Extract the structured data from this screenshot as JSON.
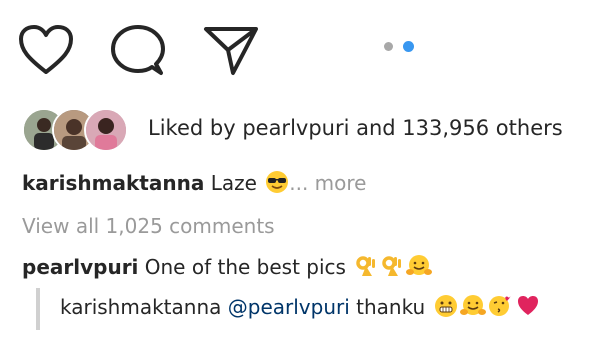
{
  "actions": {
    "icons": [
      "heart-icon",
      "comment-icon",
      "share-icon"
    ],
    "carousel": {
      "count": 2,
      "active_index": 1,
      "active_color": "#3897f0",
      "inactive_color": "#a8a8a8"
    }
  },
  "likes": {
    "prefix": "Liked by ",
    "username": "pearlvpuri",
    "suffix": " and 133,956 others"
  },
  "caption": {
    "username": "karishmaktanna",
    "text": "Laze",
    "emoji": "sunglasses-face-icon",
    "more": "... more"
  },
  "view_all": "View all 1,025 comments",
  "comment": {
    "username": "pearlvpuri",
    "text": "One of the best pics",
    "emojis": [
      "ok-hand-icon",
      "ok-hand-icon",
      "hugging-face-icon"
    ]
  },
  "reply": {
    "username": "karishmaktanna",
    "mention": "@pearlvpuri",
    "text": "thanku",
    "emojis": [
      "grimacing-face-icon",
      "hugging-face-icon",
      "kissing-face-icon",
      "red-heart-icon"
    ]
  }
}
